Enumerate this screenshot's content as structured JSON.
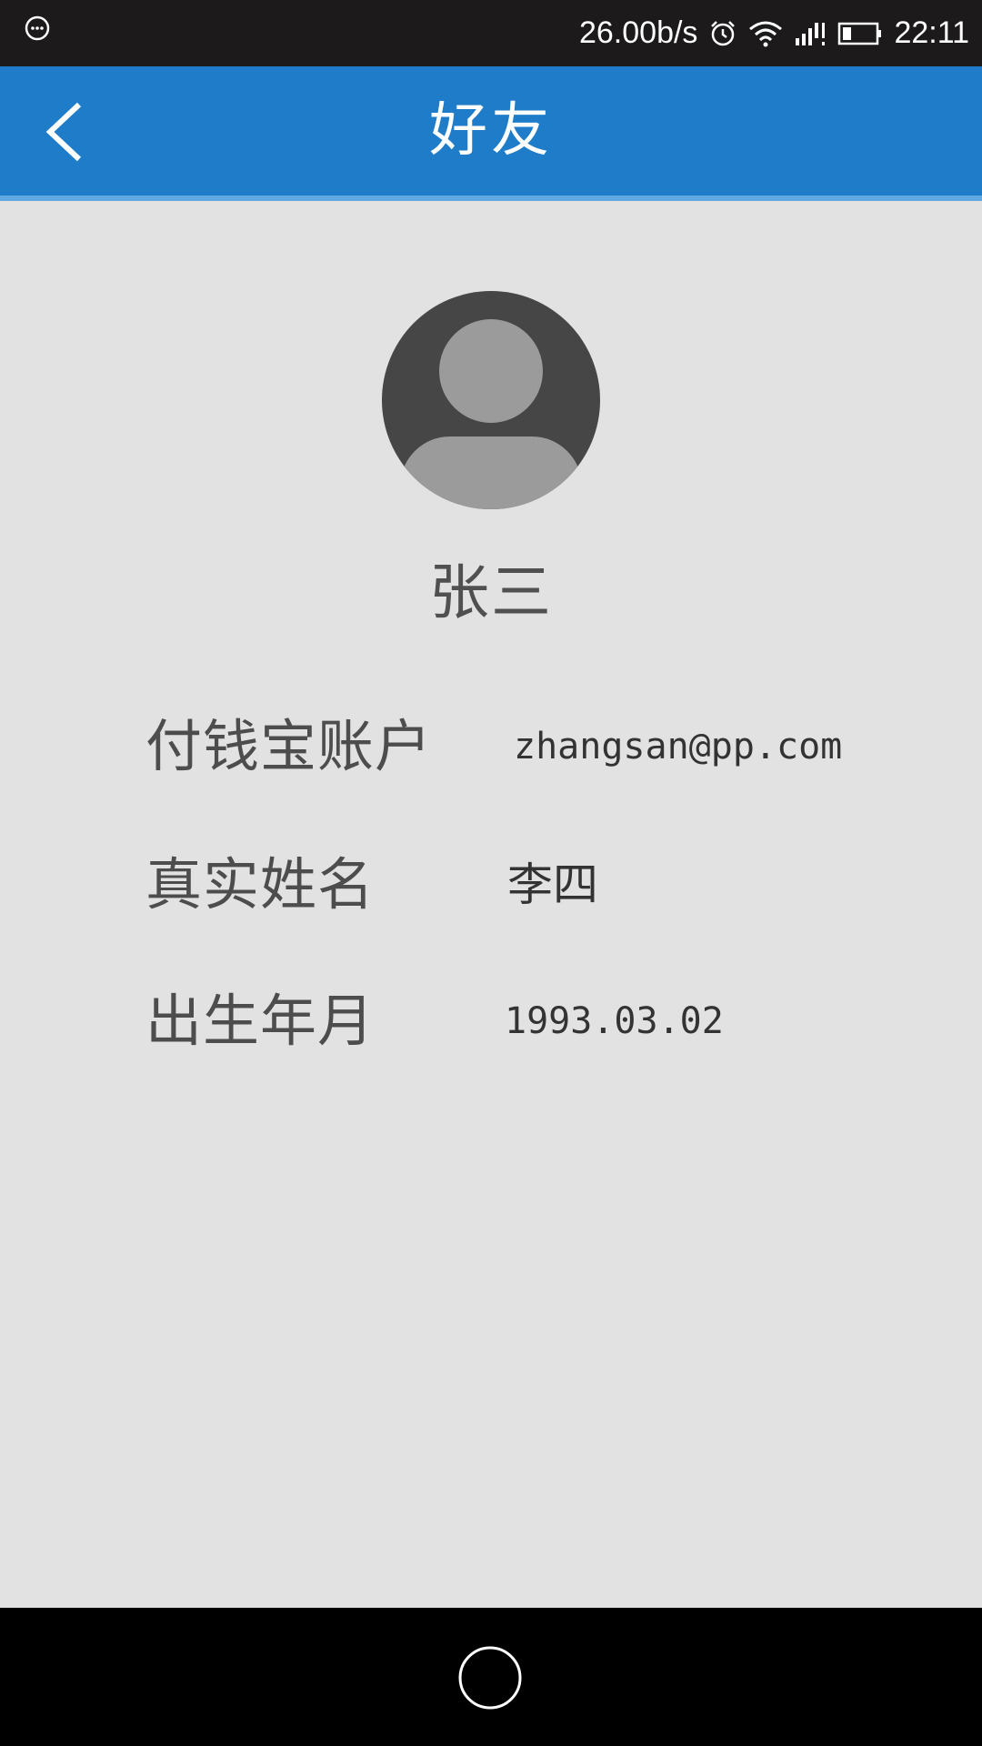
{
  "status_bar": {
    "network_speed": "26.00b/s",
    "time": "22:11",
    "icons": [
      "message-icon",
      "alarm-icon",
      "wifi-icon",
      "signal-icon",
      "battery-icon"
    ]
  },
  "header": {
    "title": "好友",
    "back_icon": "chevron-left-icon",
    "background_color": "#1e7cc8"
  },
  "profile": {
    "avatar_icon": "default-avatar-icon",
    "name": "张三"
  },
  "details": [
    {
      "label": "付钱宝账户",
      "value": "zhangsan@pp.com"
    },
    {
      "label": "真实姓名",
      "value": "李四"
    },
    {
      "label": "出生年月",
      "value": "1993.03.02"
    }
  ],
  "nav_bar": {
    "home_icon": "home-circle-icon"
  },
  "colors": {
    "background": "#e2e2e3",
    "accent": "#1e7cc8",
    "status_bar": "#1c1a1b",
    "nav_bar": "#000000"
  }
}
